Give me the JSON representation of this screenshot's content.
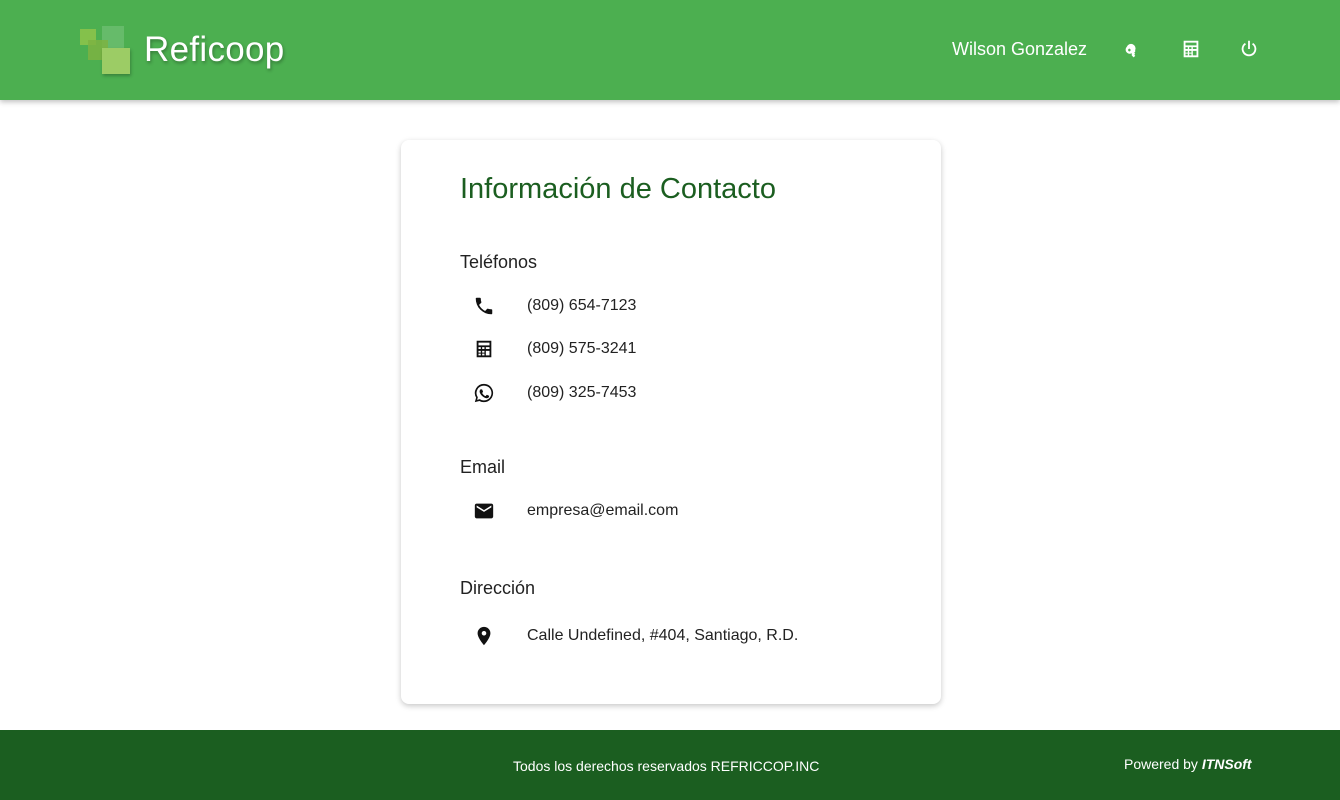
{
  "header": {
    "app_name": "Reficoop",
    "user_name": "Wilson Gonzalez",
    "icons": [
      "key-icon",
      "calculator-icon",
      "power-icon"
    ],
    "color": "#4caf50"
  },
  "card": {
    "title": "Información de Contacto",
    "phones": {
      "heading": "Teléfonos",
      "items": [
        {
          "icon": "phone-icon",
          "value": "(809) 654-7123"
        },
        {
          "icon": "calculator-icon",
          "value": "(809) 575-3241"
        },
        {
          "icon": "whatsapp-icon",
          "value": "(809) 325-7453"
        }
      ]
    },
    "email": {
      "heading": "Email",
      "icon": "mail-icon",
      "value": "empresa@email.com"
    },
    "address": {
      "heading": "Dirección",
      "icon": "location-pin-icon",
      "value": "Calle Undefined, #404, Santiago, R.D."
    }
  },
  "footer": {
    "copyright": "Todos los derechos reservados REFRICCOP.INC",
    "powered_prefix": "Powered by",
    "powered_brand": "ITNSoft",
    "color": "#1b5e20"
  }
}
